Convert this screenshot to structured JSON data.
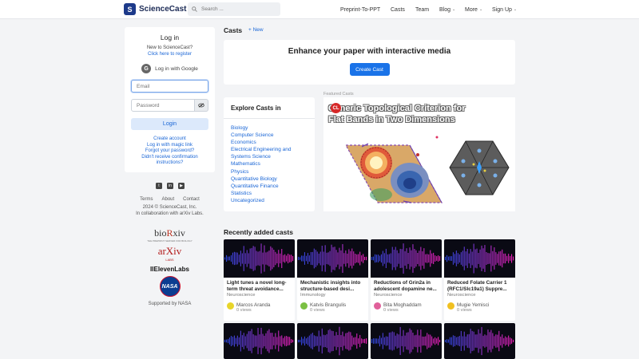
{
  "header": {
    "logo_text": "ScienceCast",
    "search_placeholder": "Search ...",
    "nav": {
      "preprint": "Preprint-To-PPT",
      "casts": "Casts",
      "team": "Team",
      "blog": "Blog",
      "more": "More",
      "signup": "Sign Up"
    }
  },
  "login": {
    "title": "Log in",
    "new_text": "New to ScienceCast?",
    "register_link": "Click here to register",
    "google": "Log in with Google",
    "email_placeholder": "Email",
    "password_placeholder": "Password",
    "login_button": "Login",
    "links": [
      "Create account",
      "Log in with magic link",
      "Forgot your password?",
      "Didn't receive confirmation",
      "instructions?"
    ]
  },
  "footer": {
    "terms": "Terms",
    "about": "About",
    "contact": "Contact",
    "copyright": "2024 © ScienceCast, Inc.",
    "collab": "In collaboration with arXiv Labs.",
    "partners": {
      "biorxiv_pre": "bio",
      "biorxiv_r": "R",
      "biorxiv_post": "xiv",
      "biorxiv_tag": "THE PREPRINT SERVER FOR BIOLOGY",
      "arxiv": "arXiv",
      "arxiv_labs": "LABS",
      "eleven": "IIElevenLabs",
      "nasa": "NASA",
      "supported": "Supported by NASA"
    }
  },
  "main": {
    "casts_title": "Casts",
    "new_link": "+ New",
    "enhance_title": "Enhance your paper with interactive media",
    "create_button": "Create Cast",
    "explore_title": "Explore Casts in",
    "categories": [
      "Biology",
      "Computer Science",
      "Economics",
      "Electrical Engineering and",
      "Systems Science",
      "Mathematics",
      "Physics",
      "Quantitative Biology",
      "Quantitative Finance",
      "Statistics",
      "Uncategorized"
    ],
    "featured_label": "Featured Casts",
    "featured_badge": "CL",
    "featured_line1": "Generic Topological Criterion for",
    "featured_line2": "Flat Bands in Two Dimensions",
    "recent_title": "Recently added casts",
    "cards": [
      {
        "title": "Light tunes a novel long-term threat avoidance...",
        "category": "Neuroscience",
        "author": "Marcos Aranda",
        "views": "0 views",
        "avatar_color": "#e8d52a"
      },
      {
        "title": "Mechanistic insights into structure-based desi...",
        "category": "Immunology",
        "author": "Katvis Brangulis",
        "views": "0 views",
        "avatar_color": "#7bc043"
      },
      {
        "title": "Reductions of Grin2a in adolescent dopamine ne...",
        "category": "Neuroscience",
        "author": "Bita Moghaddam",
        "views": "0 views",
        "avatar_color": "#e0609a"
      },
      {
        "title": "Reduced Folate Carrier 1 (RFC1/Slc19a1) Suppre...",
        "category": "Neuroscience",
        "author": "Mugie Yemisci",
        "views": "0 views",
        "avatar_color": "#f0c020"
      }
    ]
  }
}
